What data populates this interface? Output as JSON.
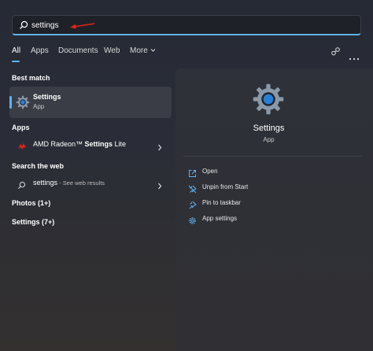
{
  "search": {
    "value": "settings"
  },
  "tabs": [
    {
      "label": "All",
      "active": true
    },
    {
      "label": "Apps"
    },
    {
      "label": "Documents"
    },
    {
      "label": "Web"
    },
    {
      "label": "More"
    }
  ],
  "sections": {
    "best_match": "Best match",
    "apps": "Apps",
    "search_web": "Search the web",
    "photos": "Photos (1+)",
    "settings_more": "Settings (7+)"
  },
  "best_match": {
    "title": "Settings",
    "subtitle": "App"
  },
  "apps": [
    {
      "name_prefix": "AMD Radeon™ ",
      "name_bold": "Settings",
      "name_suffix": " Lite"
    }
  ],
  "web": {
    "query": "settings",
    "suffix": " - See web results"
  },
  "detail": {
    "title": "Settings",
    "subtitle": "App",
    "actions": [
      "Open",
      "Unpin from Start",
      "Pin to taskbar",
      "App settings"
    ]
  },
  "colors": {
    "accent": "#5fb2f2",
    "annotation_arrow": "#e0241c",
    "amd_red": "#e0241c"
  }
}
